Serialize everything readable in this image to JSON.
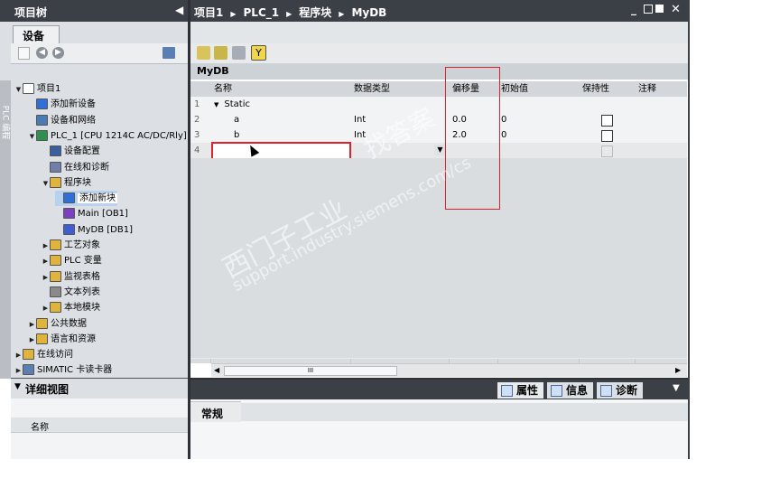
{
  "left_panel": {
    "title": "项目树",
    "tab": "设备",
    "vertical_tab": "PLC 编程"
  },
  "tree": [
    {
      "label": "项目1",
      "level": 0,
      "arrow": "down",
      "icon": "project-icon",
      "color": "#ffffff"
    },
    {
      "label": "添加新设备",
      "level": 1,
      "arrow": "",
      "icon": "add-device-icon",
      "color": "#2f6fd6"
    },
    {
      "label": "设备和网络",
      "level": 1,
      "arrow": "",
      "icon": "network-icon",
      "color": "#4a7bb5"
    },
    {
      "label": "PLC_1 [CPU 1214C AC/DC/Rly]",
      "level": 1,
      "arrow": "down",
      "icon": "plc-icon",
      "color": "#2f8f4e"
    },
    {
      "label": "设备配置",
      "level": 2,
      "arrow": "",
      "icon": "device-config-icon",
      "color": "#3a5f9e"
    },
    {
      "label": "在线和诊断",
      "level": 2,
      "arrow": "",
      "icon": "online-diag-icon",
      "color": "#6f7fa8"
    },
    {
      "label": "程序块",
      "level": 2,
      "arrow": "down",
      "icon": "folder-icon",
      "color": "#e0b43c"
    },
    {
      "label": "添加新块",
      "level": 3,
      "arrow": "",
      "icon": "add-block-icon",
      "color": "#2f6fd6",
      "selected": true
    },
    {
      "label": "Main [OB1]",
      "level": 3,
      "arrow": "",
      "icon": "ob-icon",
      "color": "#7b3fbf"
    },
    {
      "label": "MyDB [DB1]",
      "level": 3,
      "arrow": "",
      "icon": "db-icon",
      "color": "#3f5fd0"
    },
    {
      "label": "工艺对象",
      "level": 2,
      "arrow": "right",
      "icon": "folder-icon",
      "color": "#e0b43c"
    },
    {
      "label": "PLC 变量",
      "level": 2,
      "arrow": "right",
      "icon": "folder-icon",
      "color": "#e0b43c"
    },
    {
      "label": "监视表格",
      "level": 2,
      "arrow": "right",
      "icon": "folder-icon",
      "color": "#e0b43c"
    },
    {
      "label": "文本列表",
      "level": 2,
      "arrow": "",
      "icon": "text-list-icon",
      "color": "#8a8a8a"
    },
    {
      "label": "本地模块",
      "level": 2,
      "arrow": "right",
      "icon": "folder-icon",
      "color": "#e0b43c"
    },
    {
      "label": "公共数据",
      "level": 1,
      "arrow": "right",
      "icon": "folder-icon",
      "color": "#e0b43c"
    },
    {
      "label": "语言和资源",
      "level": 1,
      "arrow": "right",
      "icon": "folder-icon",
      "color": "#e0b43c"
    },
    {
      "label": "在线访问",
      "level": 0,
      "arrow": "right",
      "icon": "folder-icon",
      "color": "#e0b43c"
    },
    {
      "label": "SIMATIC 卡读卡器",
      "level": 0,
      "arrow": "right",
      "icon": "card-reader-icon",
      "color": "#5b7fb0"
    }
  ],
  "detail_view": {
    "title": "详细视图",
    "column": "名称"
  },
  "editor": {
    "breadcrumb": [
      "项目1",
      "PLC_1",
      "程序块",
      "MyDB"
    ],
    "db_name": "MyDB",
    "columns": [
      "名称",
      "数据类型",
      "偏移量",
      "初始值",
      "保持性",
      "注释"
    ],
    "rows": [
      {
        "num": "1",
        "name": "Static",
        "type": "",
        "offset": "",
        "init": "",
        "retain": "none",
        "group": true
      },
      {
        "num": "2",
        "name": "a",
        "type": "Int",
        "offset": "0.0",
        "init": "0",
        "retain": "box"
      },
      {
        "num": "3",
        "name": "b",
        "type": "Int",
        "offset": "2.0",
        "init": "0",
        "retain": "box"
      },
      {
        "num": "4",
        "name": "",
        "type": "",
        "offset": "",
        "init": "",
        "retain": "dim",
        "editing": true
      }
    ],
    "scroll_mark": "III"
  },
  "bottom_panel": {
    "tabs": [
      "属性",
      "信息",
      "诊断"
    ],
    "section": "常规"
  },
  "watermark": {
    "line1": "西门子工业",
    "line2": "support.industry.siemens.com/cs",
    "line3": "找答案"
  },
  "colors": {
    "header_bg": "#3b3f46",
    "highlight_red": "#e0202a",
    "selection": "#b6d2ee"
  }
}
